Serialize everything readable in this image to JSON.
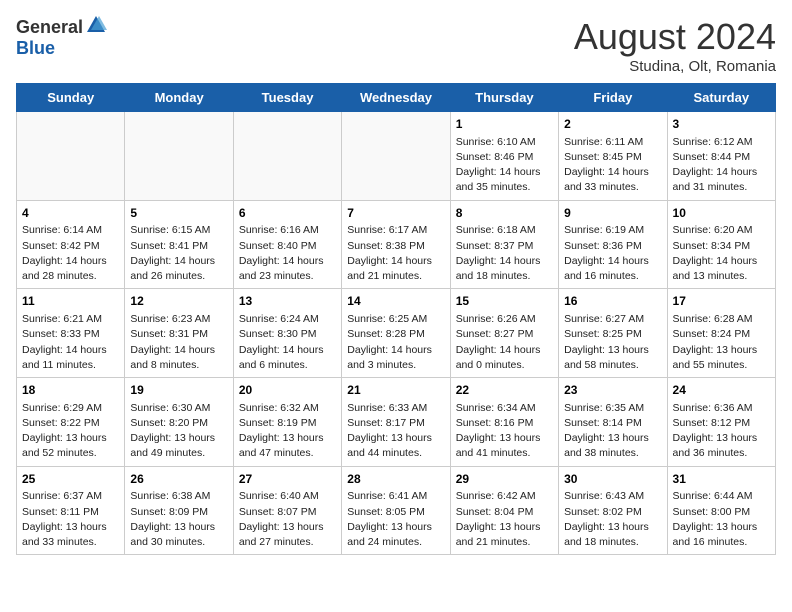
{
  "header": {
    "logo_general": "General",
    "logo_blue": "Blue",
    "month_year": "August 2024",
    "location": "Studina, Olt, Romania"
  },
  "days_of_week": [
    "Sunday",
    "Monday",
    "Tuesday",
    "Wednesday",
    "Thursday",
    "Friday",
    "Saturday"
  ],
  "weeks": [
    {
      "days": [
        {
          "num": "",
          "text": ""
        },
        {
          "num": "",
          "text": ""
        },
        {
          "num": "",
          "text": ""
        },
        {
          "num": "",
          "text": ""
        },
        {
          "num": "1",
          "text": "Sunrise: 6:10 AM\nSunset: 8:46 PM\nDaylight: 14 hours and 35 minutes."
        },
        {
          "num": "2",
          "text": "Sunrise: 6:11 AM\nSunset: 8:45 PM\nDaylight: 14 hours and 33 minutes."
        },
        {
          "num": "3",
          "text": "Sunrise: 6:12 AM\nSunset: 8:44 PM\nDaylight: 14 hours and 31 minutes."
        }
      ]
    },
    {
      "days": [
        {
          "num": "4",
          "text": "Sunrise: 6:14 AM\nSunset: 8:42 PM\nDaylight: 14 hours and 28 minutes."
        },
        {
          "num": "5",
          "text": "Sunrise: 6:15 AM\nSunset: 8:41 PM\nDaylight: 14 hours and 26 minutes."
        },
        {
          "num": "6",
          "text": "Sunrise: 6:16 AM\nSunset: 8:40 PM\nDaylight: 14 hours and 23 minutes."
        },
        {
          "num": "7",
          "text": "Sunrise: 6:17 AM\nSunset: 8:38 PM\nDaylight: 14 hours and 21 minutes."
        },
        {
          "num": "8",
          "text": "Sunrise: 6:18 AM\nSunset: 8:37 PM\nDaylight: 14 hours and 18 minutes."
        },
        {
          "num": "9",
          "text": "Sunrise: 6:19 AM\nSunset: 8:36 PM\nDaylight: 14 hours and 16 minutes."
        },
        {
          "num": "10",
          "text": "Sunrise: 6:20 AM\nSunset: 8:34 PM\nDaylight: 14 hours and 13 minutes."
        }
      ]
    },
    {
      "days": [
        {
          "num": "11",
          "text": "Sunrise: 6:21 AM\nSunset: 8:33 PM\nDaylight: 14 hours and 11 minutes."
        },
        {
          "num": "12",
          "text": "Sunrise: 6:23 AM\nSunset: 8:31 PM\nDaylight: 14 hours and 8 minutes."
        },
        {
          "num": "13",
          "text": "Sunrise: 6:24 AM\nSunset: 8:30 PM\nDaylight: 14 hours and 6 minutes."
        },
        {
          "num": "14",
          "text": "Sunrise: 6:25 AM\nSunset: 8:28 PM\nDaylight: 14 hours and 3 minutes."
        },
        {
          "num": "15",
          "text": "Sunrise: 6:26 AM\nSunset: 8:27 PM\nDaylight: 14 hours and 0 minutes."
        },
        {
          "num": "16",
          "text": "Sunrise: 6:27 AM\nSunset: 8:25 PM\nDaylight: 13 hours and 58 minutes."
        },
        {
          "num": "17",
          "text": "Sunrise: 6:28 AM\nSunset: 8:24 PM\nDaylight: 13 hours and 55 minutes."
        }
      ]
    },
    {
      "days": [
        {
          "num": "18",
          "text": "Sunrise: 6:29 AM\nSunset: 8:22 PM\nDaylight: 13 hours and 52 minutes."
        },
        {
          "num": "19",
          "text": "Sunrise: 6:30 AM\nSunset: 8:20 PM\nDaylight: 13 hours and 49 minutes."
        },
        {
          "num": "20",
          "text": "Sunrise: 6:32 AM\nSunset: 8:19 PM\nDaylight: 13 hours and 47 minutes."
        },
        {
          "num": "21",
          "text": "Sunrise: 6:33 AM\nSunset: 8:17 PM\nDaylight: 13 hours and 44 minutes."
        },
        {
          "num": "22",
          "text": "Sunrise: 6:34 AM\nSunset: 8:16 PM\nDaylight: 13 hours and 41 minutes."
        },
        {
          "num": "23",
          "text": "Sunrise: 6:35 AM\nSunset: 8:14 PM\nDaylight: 13 hours and 38 minutes."
        },
        {
          "num": "24",
          "text": "Sunrise: 6:36 AM\nSunset: 8:12 PM\nDaylight: 13 hours and 36 minutes."
        }
      ]
    },
    {
      "days": [
        {
          "num": "25",
          "text": "Sunrise: 6:37 AM\nSunset: 8:11 PM\nDaylight: 13 hours and 33 minutes."
        },
        {
          "num": "26",
          "text": "Sunrise: 6:38 AM\nSunset: 8:09 PM\nDaylight: 13 hours and 30 minutes."
        },
        {
          "num": "27",
          "text": "Sunrise: 6:40 AM\nSunset: 8:07 PM\nDaylight: 13 hours and 27 minutes."
        },
        {
          "num": "28",
          "text": "Sunrise: 6:41 AM\nSunset: 8:05 PM\nDaylight: 13 hours and 24 minutes."
        },
        {
          "num": "29",
          "text": "Sunrise: 6:42 AM\nSunset: 8:04 PM\nDaylight: 13 hours and 21 minutes."
        },
        {
          "num": "30",
          "text": "Sunrise: 6:43 AM\nSunset: 8:02 PM\nDaylight: 13 hours and 18 minutes."
        },
        {
          "num": "31",
          "text": "Sunrise: 6:44 AM\nSunset: 8:00 PM\nDaylight: 13 hours and 16 minutes."
        }
      ]
    }
  ]
}
